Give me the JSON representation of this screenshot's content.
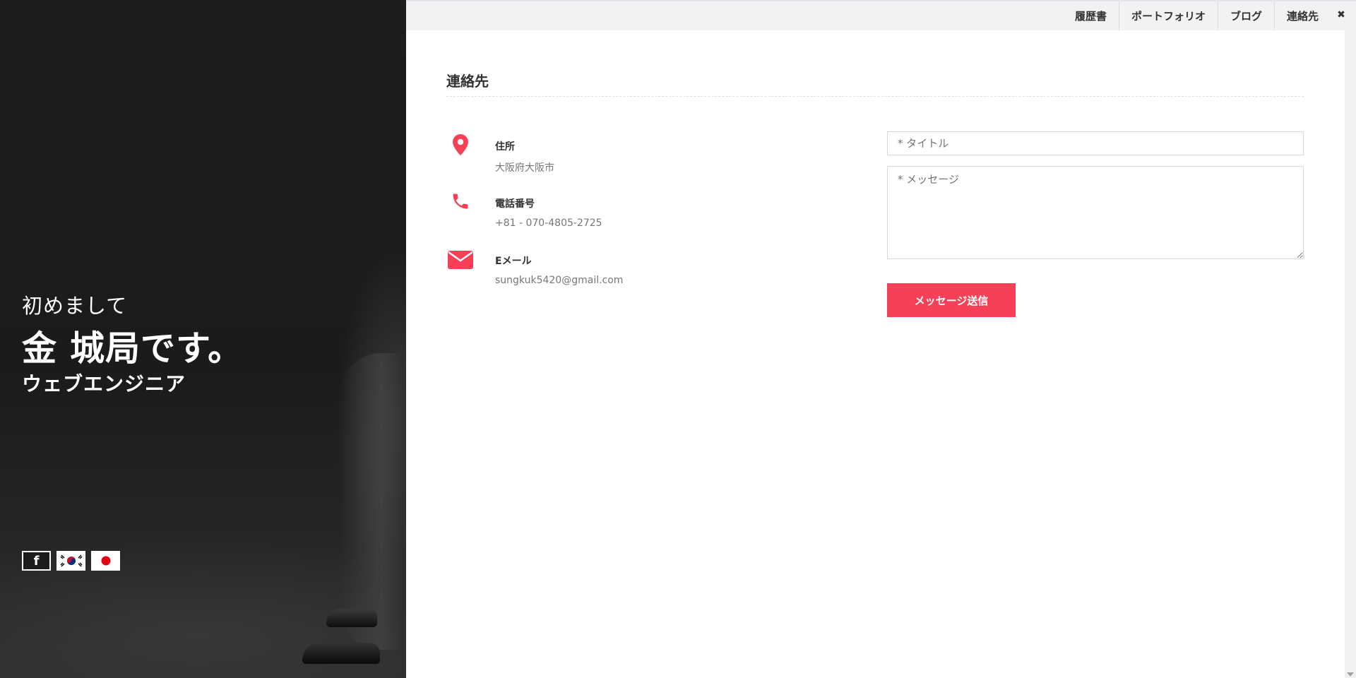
{
  "hero": {
    "greeting": "初めまして",
    "name": "金 城局です。",
    "job": "ウェブエンジニア",
    "social": [
      {
        "icon": "facebook-icon",
        "label": "f"
      },
      {
        "icon": "korea-flag-icon"
      },
      {
        "icon": "japan-flag-icon"
      }
    ]
  },
  "nav": {
    "items": [
      "履歴書",
      "ポートフォリオ",
      "ブログ",
      "連絡先"
    ],
    "close_label": "✖"
  },
  "contact": {
    "title": "連絡先",
    "info": [
      {
        "icon": "map-pin-icon",
        "label": "住所",
        "value": "大阪府大阪市"
      },
      {
        "icon": "phone-icon",
        "label": "電話番号",
        "value": "+81 - 070-4805-2725"
      },
      {
        "icon": "envelope-icon",
        "label": "Eメール",
        "value": "sungkuk5420@gmail.com"
      }
    ],
    "form": {
      "title_placeholder": "* タイトル",
      "message_placeholder": "* メッセージ",
      "submit_label": "メッセージ送信"
    }
  },
  "colors": {
    "accent": "#f54058",
    "hero_bg": "#1d1d1d",
    "nav_bg": "#f1f2f4"
  }
}
